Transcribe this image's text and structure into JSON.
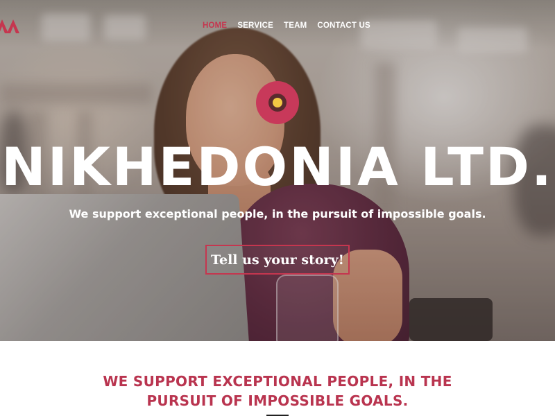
{
  "nav": {
    "items": [
      {
        "label": "HOME",
        "active": true
      },
      {
        "label": "SERVICE",
        "active": false
      },
      {
        "label": "TEAM",
        "active": false
      },
      {
        "label": "CONTACT US",
        "active": false
      }
    ]
  },
  "hero": {
    "title": "NIKHEDONIA LTD.",
    "subtitle": "We support exceptional people, in the pursuit of impossible goals.",
    "cta_label": "Tell us your story!"
  },
  "intro": {
    "heading_line1": "WE SUPPORT EXCEPTIONAL PEOPLE, IN THE",
    "heading_line2": "PURSUIT OF IMPOSSIBLE GOALS."
  },
  "colors": {
    "accent": "#c5364f",
    "heading": "#b9344f",
    "badge_center": "#f2c744"
  },
  "icons": {
    "logo": "brand-logo-icon",
    "badge": "target-badge-icon"
  }
}
